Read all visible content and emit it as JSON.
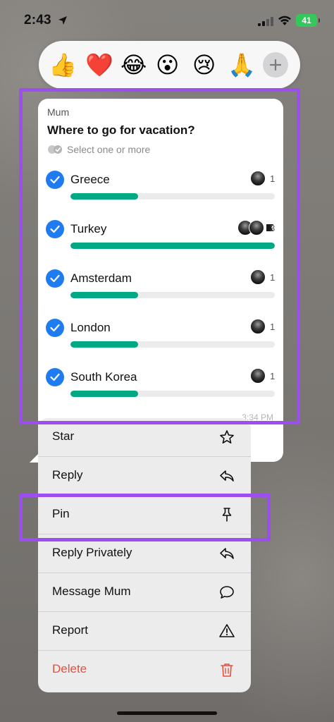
{
  "status_bar": {
    "time": "2:43",
    "battery": "41"
  },
  "reactions": {
    "emojis": [
      "👍",
      "❤️",
      "😂",
      "😮",
      "😢",
      "🙏"
    ],
    "more_icon": "plus-icon"
  },
  "poll": {
    "sender": "Mum",
    "question": "Where to go for vacation?",
    "hint": "Select one or more",
    "options": [
      {
        "label": "Greece",
        "votes": "1",
        "fraction": 0.33
      },
      {
        "label": "Turkey",
        "votes": "3",
        "fraction": 1.0
      },
      {
        "label": "Amsterdam",
        "votes": "1",
        "fraction": 0.33
      },
      {
        "label": "London",
        "votes": "1",
        "fraction": 0.33
      },
      {
        "label": "South Korea",
        "votes": "1",
        "fraction": 0.33
      }
    ],
    "time": "3:34 PM"
  },
  "menu": {
    "items": [
      {
        "label": "Star",
        "icon": "star-icon"
      },
      {
        "label": "Reply",
        "icon": "reply-icon"
      },
      {
        "label": "Pin",
        "icon": "pin-icon"
      },
      {
        "label": "Reply Privately",
        "icon": "reply-privately-icon"
      },
      {
        "label": "Message Mum",
        "icon": "chat-bubble-icon"
      },
      {
        "label": "Report",
        "icon": "warning-icon"
      },
      {
        "label": "Delete",
        "icon": "trash-icon"
      }
    ]
  },
  "colors": {
    "accent_highlight": "#9d4ef0",
    "check_blue": "#1f7cf0",
    "bar_green": "#00a884",
    "delete_red": "#ea4d3d"
  }
}
